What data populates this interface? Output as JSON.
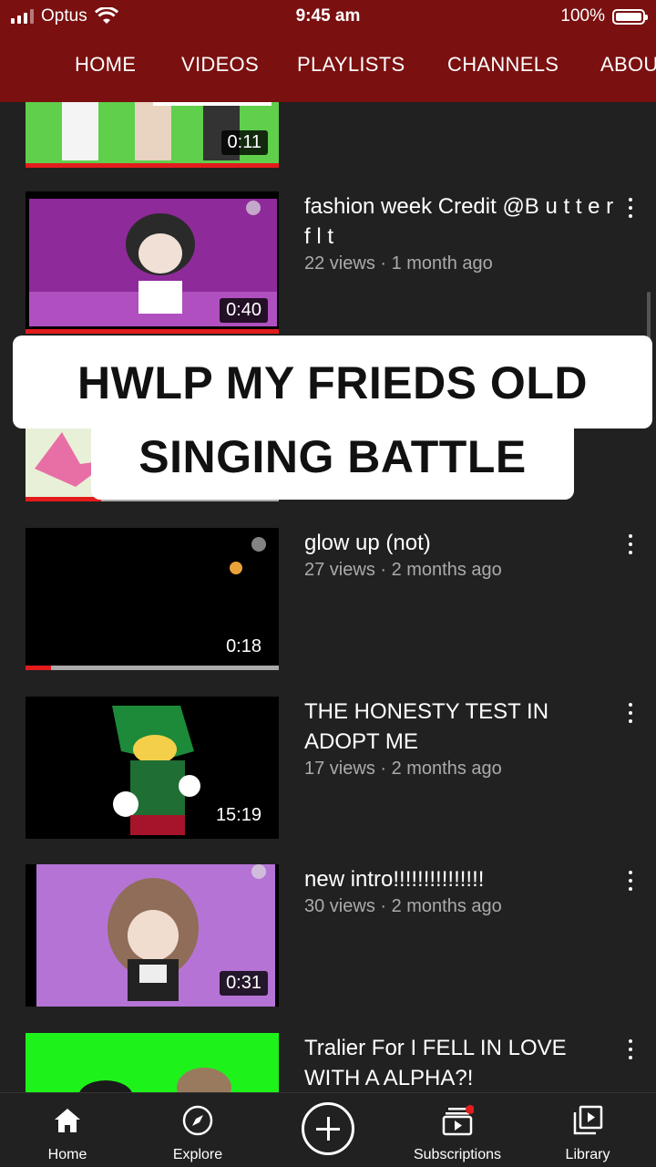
{
  "status_bar": {
    "carrier": "Optus",
    "time": "9:45 am",
    "battery": "100%"
  },
  "tabs": [
    "HOME",
    "VIDEOS",
    "PLAYLISTS",
    "CHANNELS",
    "ABOU"
  ],
  "videos": [
    {
      "duration": "0:11",
      "title": "",
      "meta": ""
    },
    {
      "duration": "0:40",
      "title": "fashion week Credit @B u t t e r f l t",
      "meta": "22 views · 1 month ago"
    },
    {
      "duration": "",
      "title": "",
      "meta": ""
    },
    {
      "duration": "0:18",
      "title": "glow up (not)",
      "meta": "27 views · 2 months ago"
    },
    {
      "duration": "15:19",
      "title": "THE HONESTY TEST IN ADOPT ME",
      "meta": "17 views · 2 months ago"
    },
    {
      "duration": "0:31",
      "title": "new intro!!!!!!!!!!!!!!!",
      "meta": "30 views · 2 months ago"
    },
    {
      "duration": "",
      "title": "Tralier For  I FELL IN LOVE WITH A ALPHA?!",
      "meta": ""
    }
  ],
  "progress": {
    "video_0": 1.0,
    "video_1": 1.0,
    "video_2": 0.3,
    "video_3": 0.1
  },
  "overlay_caption": {
    "line1": "HWLP MY FRIEDS OLD",
    "line2": "SINGING BATTLE"
  },
  "bottom_nav": [
    {
      "label": "Home",
      "icon": "home-icon"
    },
    {
      "label": "Explore",
      "icon": "compass-icon"
    },
    {
      "label": "",
      "icon": "create-plus-icon"
    },
    {
      "label": "Subscriptions",
      "icon": "subscriptions-icon"
    },
    {
      "label": "Library",
      "icon": "library-icon"
    }
  ],
  "colors": {
    "header": "#7a1010",
    "background": "#212121",
    "accent_red": "#e21c1c",
    "meta_gray": "#aaaaaa"
  }
}
